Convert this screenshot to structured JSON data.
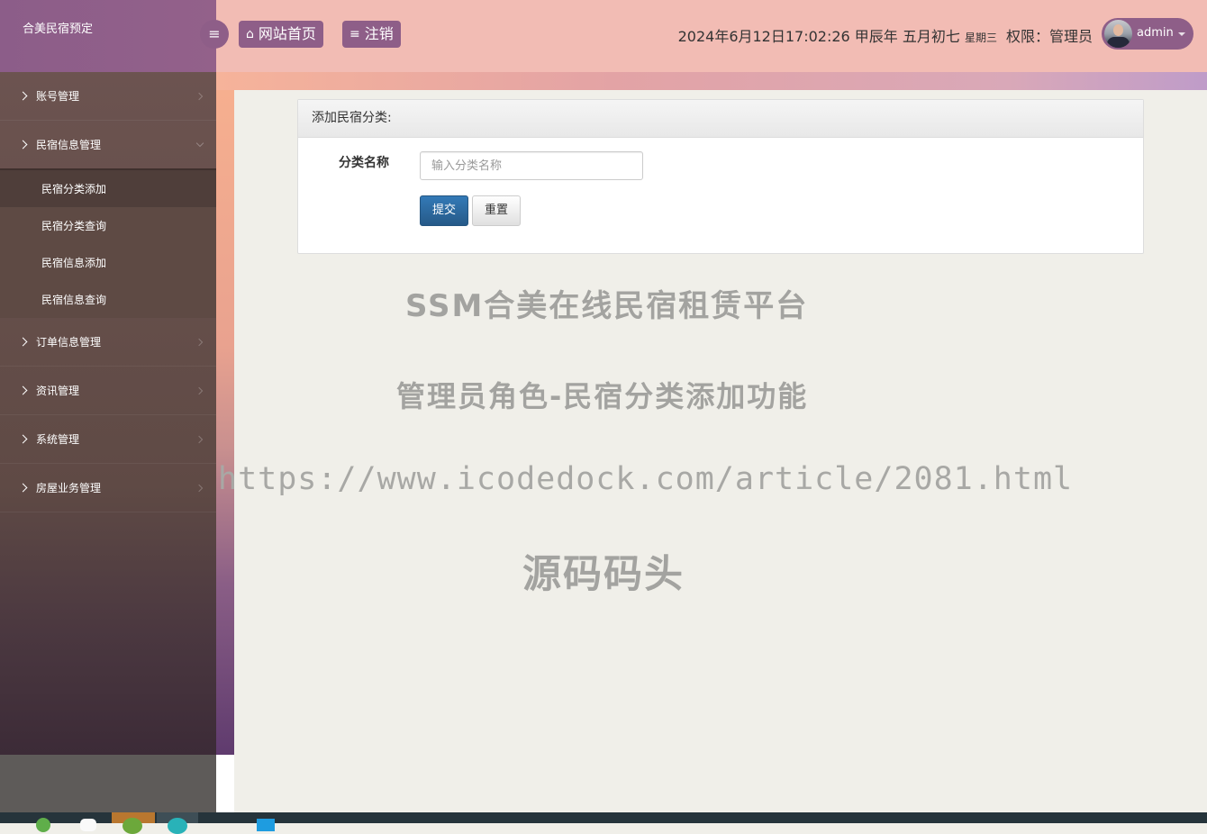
{
  "app": {
    "title": "合美民宿预定"
  },
  "header": {
    "home_label": "网站首页",
    "logout_label": "注销",
    "datetime": "2024年6月12日17:02:26 甲辰年 五月初七",
    "weekday": "星期三",
    "permission": "权限：管理员",
    "username": "admin"
  },
  "sidebar": {
    "items": [
      {
        "label": "账号管理"
      },
      {
        "label": "民宿信息管理",
        "expanded": true,
        "children": [
          {
            "label": "民宿分类添加",
            "active": true
          },
          {
            "label": "民宿分类查询"
          },
          {
            "label": "民宿信息添加"
          },
          {
            "label": "民宿信息查询"
          }
        ]
      },
      {
        "label": "订单信息管理"
      },
      {
        "label": "资讯管理"
      },
      {
        "label": "系统管理"
      },
      {
        "label": "房屋业务管理"
      }
    ]
  },
  "form": {
    "title": "添加民宿分类:",
    "field_label": "分类名称",
    "field_placeholder": "输入分类名称",
    "field_value": "",
    "submit_label": "提交",
    "reset_label": "重置"
  },
  "watermark": {
    "line1": "SSM合美在线民宿租赁平台",
    "line2": "管理员角色-民宿分类添加功能",
    "line3": "https://www.icodedock.com/article/2081.html",
    "line4": "源码码头"
  },
  "colors": {
    "header_bg": "#f2bcb4",
    "brand_bg": "#8c5d89",
    "accent": "#8e5e88",
    "sidebar_bg": "#6e5552",
    "primary_button": "#337ab7"
  }
}
